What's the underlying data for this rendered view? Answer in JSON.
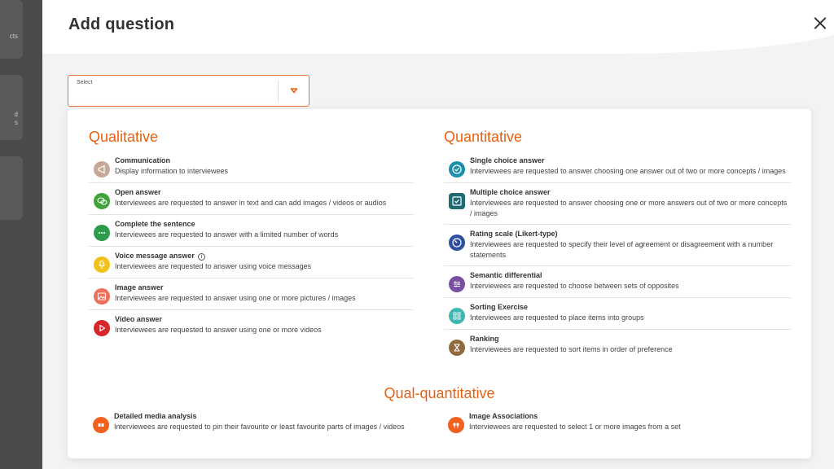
{
  "background": {
    "snippets": [
      "cts",
      "d",
      "s"
    ]
  },
  "modal": {
    "title": "Add question",
    "close_icon": "close-icon"
  },
  "select": {
    "label": "Select",
    "caret_icon": "caret-down-icon",
    "accent": "#e8743b"
  },
  "sections": {
    "qualitative": {
      "title": "Qualitative",
      "items": [
        {
          "title": "Communication",
          "desc": "Display information to interviewees",
          "icon": "megaphone-icon",
          "color": "#c5a89a"
        },
        {
          "title": "Open answer",
          "desc": "Interviewees are requested to answer in text and can add images / videos or audios",
          "icon": "chat-bubbles-icon",
          "color": "#3fa33a"
        },
        {
          "title": "Complete the sentence",
          "desc": "Interviewees are requested to answer with a limited number of words",
          "icon": "ellipsis-icon",
          "color": "#2e9b4b"
        },
        {
          "title": "Voice message answer",
          "desc": "Interviewees are requested to answer using voice messages",
          "icon": "microphone-icon",
          "color": "#f2c21b"
        },
        {
          "title": "Image answer",
          "desc": "Interviewees are requested to answer using one or more pictures / images",
          "icon": "image-icon",
          "color": "#ef6f5a"
        },
        {
          "title": "Video answer",
          "desc": "Interviewees are requested to answer using one or more videos",
          "icon": "play-icon",
          "color": "#d9262b"
        }
      ]
    },
    "quantitative": {
      "title": "Quantitative",
      "items": [
        {
          "title": "Single choice answer",
          "desc": "Interviewees are requested to answer choosing one answer out of two or more concepts / images",
          "icon": "check-circle-icon",
          "color": "#1d8fa8"
        },
        {
          "title": "Multiple choice answer",
          "desc": "Interviewees are requested to answer choosing one or more answers out of two or more concepts / images",
          "icon": "checkbox-icon",
          "color": "#1f6b73"
        },
        {
          "title": "Rating scale (Likert-type)",
          "desc": "Interviewees are requested to specify their level of agreement or disagreement with a number statements",
          "icon": "gauge-icon",
          "color": "#2c4fa0"
        },
        {
          "title": "Semantic differential",
          "desc": "Interviewees are requested to choose between sets of opposites",
          "icon": "sliders-icon",
          "color": "#7a4fa3"
        },
        {
          "title": "Sorting Exercise",
          "desc": "Interviewees are requested to place items into groups",
          "icon": "grid-icon",
          "color": "#3fb6b0"
        },
        {
          "title": "Ranking",
          "desc": "Interviewees are requested to sort items in order of preference",
          "icon": "hourglass-icon",
          "color": "#8e6a3e"
        }
      ]
    },
    "qual_quantitative": {
      "title": "Qual-quantitative",
      "items": [
        {
          "title": "Detailed media analysis",
          "desc": "Interviewees are requested to pin their favourite or least favourite parts of images / videos",
          "icon": "media-pin-icon",
          "color": "#f2601e"
        },
        {
          "title": "Image Associations",
          "desc": "Interviewees are requested to select 1 or more images from a set",
          "icon": "image-association-icon",
          "color": "#f2601e"
        }
      ]
    }
  },
  "colors": {
    "section_title": "#e8600f",
    "panel_bg": "#f2f3f5"
  }
}
